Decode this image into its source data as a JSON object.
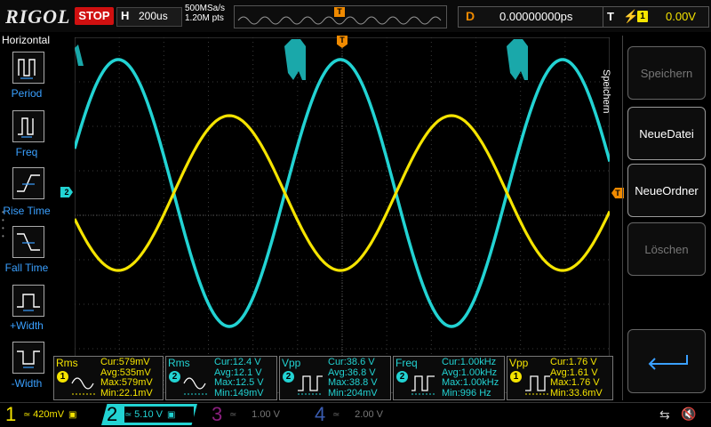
{
  "header": {
    "logo": "RIGOL",
    "run_state": "STOP",
    "horiz_letter": "H",
    "timebase": "200us",
    "sample_rate": "500MSa/s",
    "memory_points": "1.20M pts",
    "trigger_pos_marker": "T",
    "delay_letter": "D",
    "delay_value": "0.00000000ps",
    "trigger_letter": "T",
    "trigger_channel": "1",
    "trigger_level": "0.00V"
  },
  "left_panel": {
    "title": "Horizontal",
    "items": [
      {
        "label": "Period",
        "icon": "period-icon"
      },
      {
        "label": "Freq",
        "icon": "freq-icon"
      },
      {
        "label": "Rise Time",
        "icon": "rise-time-icon"
      },
      {
        "label": "Fall Time",
        "icon": "fall-time-icon"
      },
      {
        "label": "+Width",
        "icon": "positive-width-icon"
      },
      {
        "label": "-Width",
        "icon": "negative-width-icon"
      }
    ]
  },
  "right_panel": {
    "vertical_title": "Speichern",
    "buttons": [
      {
        "label": "Speichern",
        "enabled": false
      },
      {
        "label": "NeueDatei",
        "enabled": true
      },
      {
        "label": "NeueOrdner",
        "enabled": true
      },
      {
        "label": "Löschen",
        "enabled": false
      }
    ]
  },
  "markers": {
    "ch2_offset": "2",
    "trigger_level_marker": "T",
    "trigger_top_marker": "T"
  },
  "measurements": [
    {
      "name": "Rms",
      "channel": "1",
      "color": "#f5e400",
      "cur": "Cur:579mV",
      "avg": "Avg:535mV",
      "max": "Max:579mV",
      "min": "Min:22.1mV"
    },
    {
      "name": "Rms",
      "channel": "2",
      "color": "#22d3d3",
      "cur": "Cur:12.4 V",
      "avg": "Avg:12.1 V",
      "max": "Max:12.5 V",
      "min": "Min:149mV"
    },
    {
      "name": "Vpp",
      "channel": "2",
      "color": "#22d3d3",
      "cur": "Cur:38.6 V",
      "avg": "Avg:36.8 V",
      "max": "Max:38.8 V",
      "min": "Min:204mV"
    },
    {
      "name": "Freq",
      "channel": "2",
      "color": "#22d3d3",
      "cur": "Cur:1.00kHz",
      "avg": "Avg:1.00kHz",
      "max": "Max:1.00kHz",
      "min": "Min:996 Hz"
    },
    {
      "name": "Vpp",
      "channel": "1",
      "color": "#f5e400",
      "cur": "Cur:1.76 V",
      "avg": "Avg:1.61 V",
      "max": "Max:1.76 V",
      "min": "Min:33.6mV"
    }
  ],
  "channels": [
    {
      "num": "1",
      "scale": "420mV",
      "color": "#f5e400",
      "active": true
    },
    {
      "num": "2",
      "scale": "5.10 V",
      "color": "#22d3d3",
      "active": true
    },
    {
      "num": "3",
      "scale": "1.00 V",
      "color": "#b0209f",
      "active": false
    },
    {
      "num": "4",
      "scale": "2.00 V",
      "color": "#3a6cd8",
      "active": false
    }
  ],
  "colors": {
    "ch1": "#f5e400",
    "ch2": "#22d3d3",
    "accent_orange": "#f08a00",
    "stop_red": "#d01010",
    "label_blue": "#3aa0ff"
  }
}
